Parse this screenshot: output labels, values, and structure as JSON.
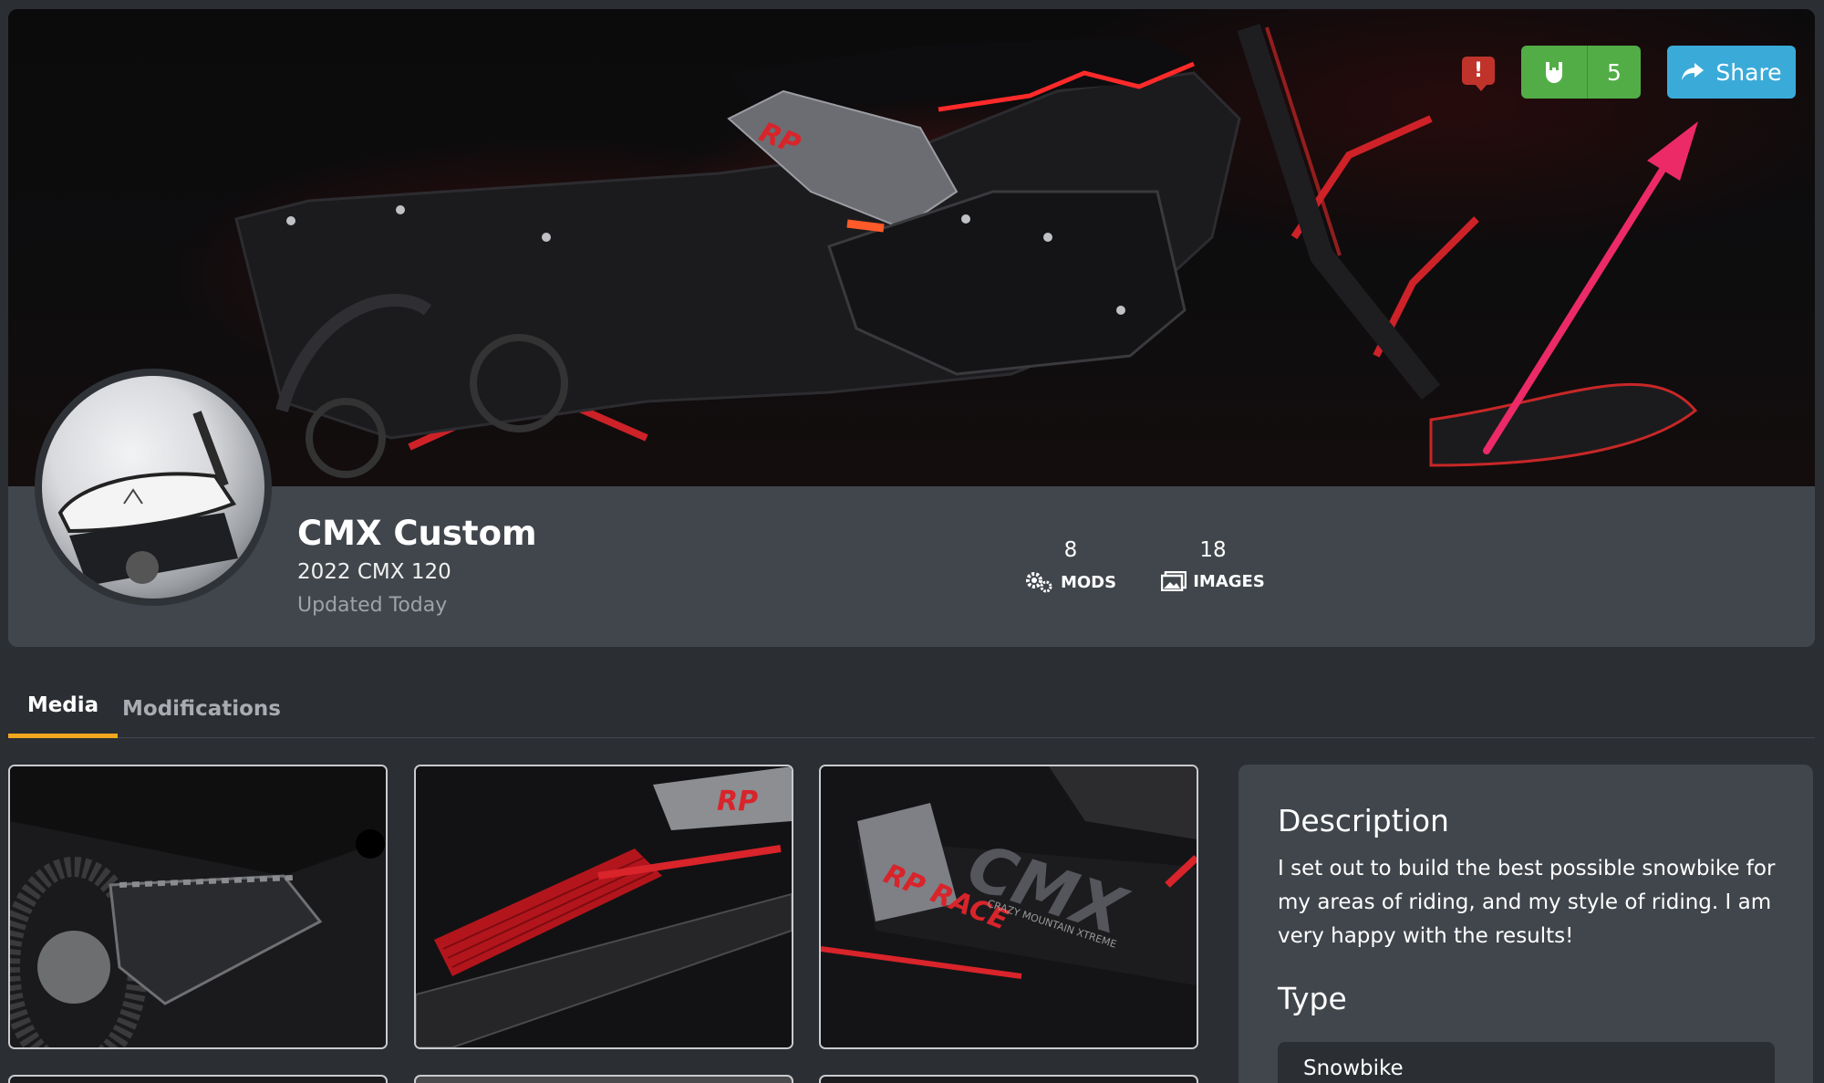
{
  "hero": {
    "share_label": "Share",
    "rock_count": "5",
    "report_glyph": "!",
    "colors": {
      "green": "#52ad47",
      "blue": "#3aabd9",
      "red": "#c0332b",
      "annotation": "#ec2a67"
    }
  },
  "profile": {
    "title": "CMX Custom",
    "subtitle": "2022 CMX 120",
    "updated": "Updated Today",
    "stats": [
      {
        "value": "8",
        "label": "MODS",
        "icon": "gears-icon"
      },
      {
        "value": "18",
        "label": "IMAGES",
        "icon": "images-icon"
      }
    ]
  },
  "tabs": [
    {
      "label": "Media",
      "active": true
    },
    {
      "label": "Modifications",
      "active": false
    }
  ],
  "card": {
    "description_heading": "Description",
    "description": "I set out to build the best possible snowbike for my areas of riding, and my style of riding. I am very happy with the results!",
    "type_heading": "Type",
    "type_value": "Snowbike"
  },
  "gallery": {
    "overlay_texts": [
      "RP RACE",
      "CMX",
      "CRAZY MOUNTAIN XTREME"
    ]
  },
  "accent": "#f2a71e"
}
